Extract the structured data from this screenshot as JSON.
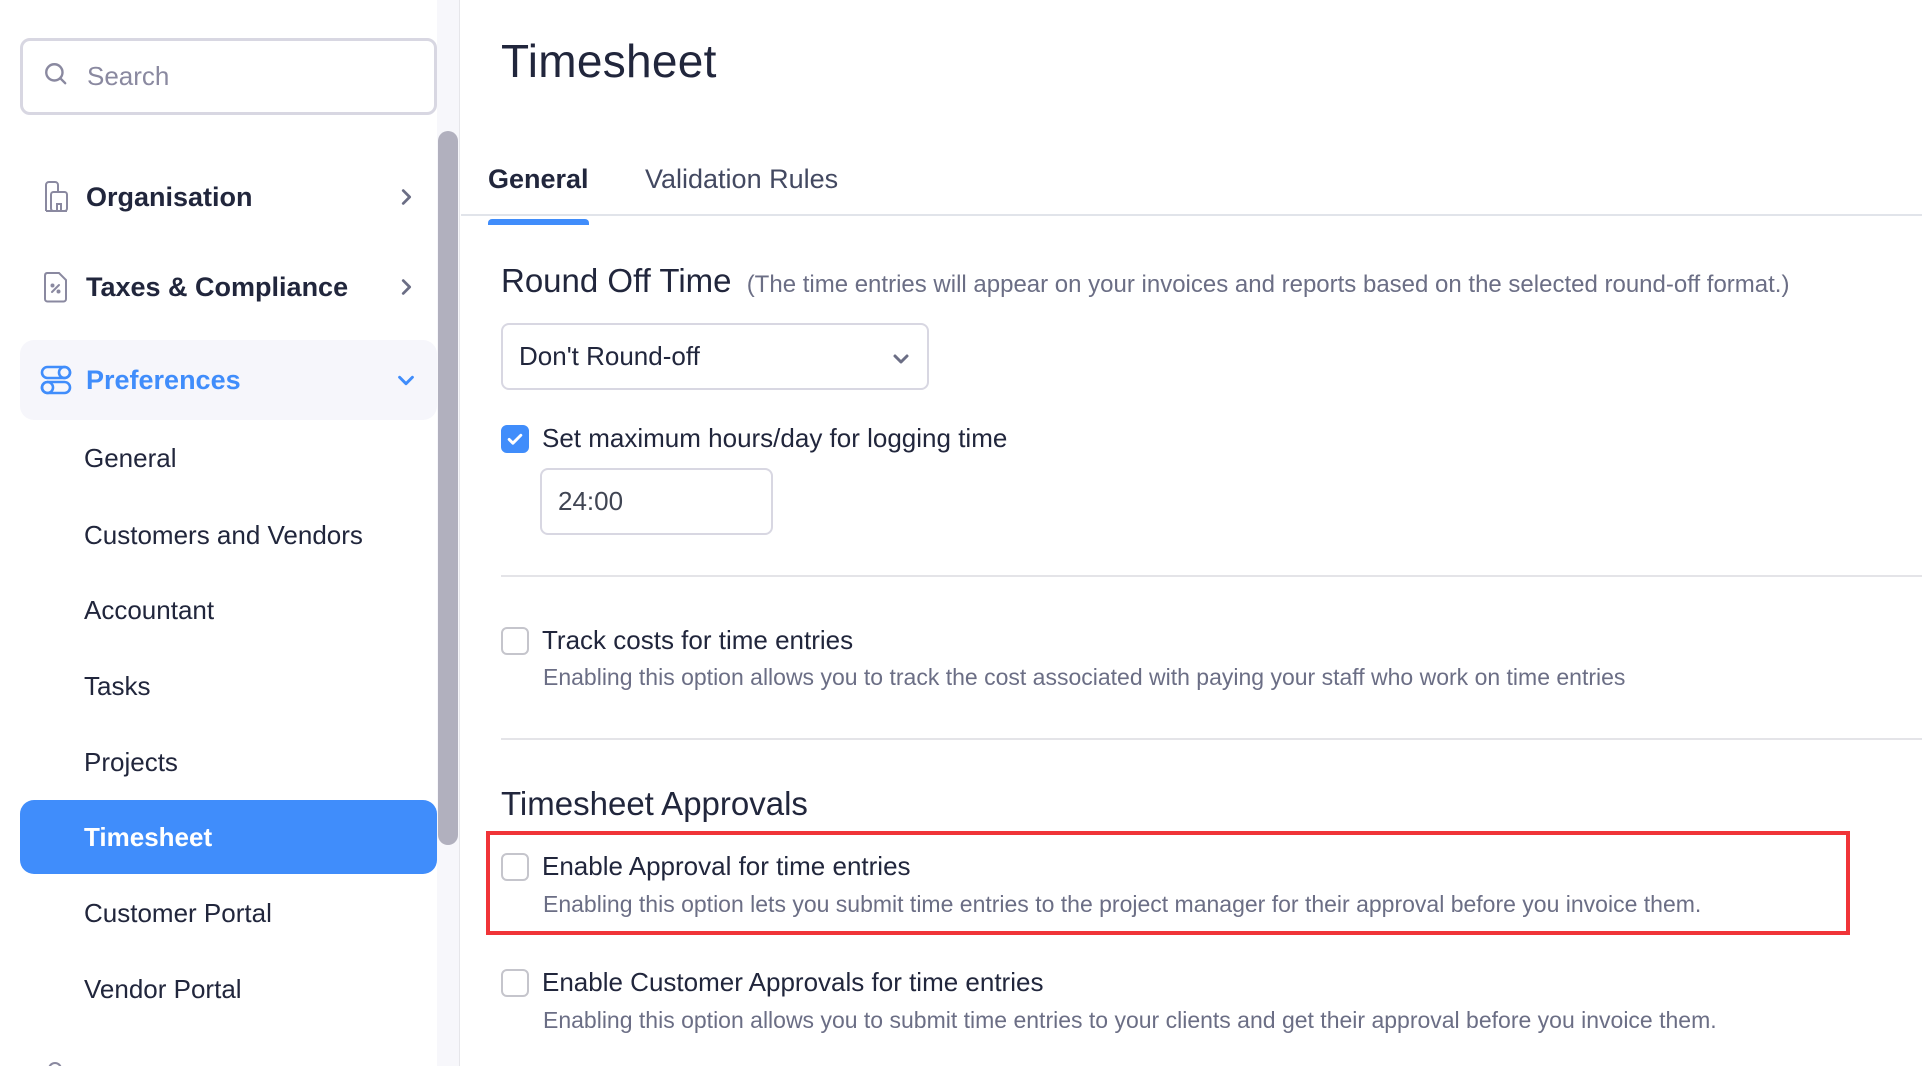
{
  "sidebar": {
    "search_placeholder": "Search",
    "sections": [
      {
        "label": "Organisation",
        "icon": "building-document-icon",
        "expanded": false
      },
      {
        "label": "Taxes & Compliance",
        "icon": "tax-document-icon",
        "expanded": false
      },
      {
        "label": "Preferences",
        "icon": "toggles-icon",
        "expanded": true
      }
    ],
    "sub_items": [
      {
        "label": "General",
        "active": false
      },
      {
        "label": "Customers and Vendors",
        "active": false
      },
      {
        "label": "Accountant",
        "active": false
      },
      {
        "label": "Tasks",
        "active": false
      },
      {
        "label": "Projects",
        "active": false
      },
      {
        "label": "Timesheet",
        "active": true
      },
      {
        "label": "Customer Portal",
        "active": false
      },
      {
        "label": "Vendor Portal",
        "active": false
      }
    ]
  },
  "main": {
    "title": "Timesheet",
    "tabs": [
      {
        "label": "General",
        "active": true
      },
      {
        "label": "Validation Rules",
        "active": false
      }
    ],
    "round_off": {
      "heading": "Round Off Time",
      "note": "(The time entries will appear on your invoices and reports based on the selected round-off format.)",
      "selected": "Don't Round-off"
    },
    "max_hours": {
      "label": "Set maximum hours/day for logging time",
      "checked": true,
      "value": "24:00"
    },
    "track_costs": {
      "label": "Track costs for time entries",
      "checked": false,
      "description": "Enabling this option allows you to track the cost associated with paying your staff who work on time entries"
    },
    "approvals": {
      "heading": "Timesheet Approvals",
      "enable_approval": {
        "label": "Enable Approval for time entries",
        "checked": false,
        "description": "Enabling this option lets you submit time entries to the project manager for their approval before you invoice them.",
        "highlighted": true
      },
      "customer_approval": {
        "label": "Enable Customer Approvals for time entries",
        "checked": false,
        "description": "Enabling this option allows you to submit time entries to your clients and get their approval before you invoice them."
      }
    }
  },
  "colors": {
    "accent": "#408dfb",
    "highlight": "#f03438",
    "text": "#21263c",
    "muted": "#6b6e85"
  }
}
